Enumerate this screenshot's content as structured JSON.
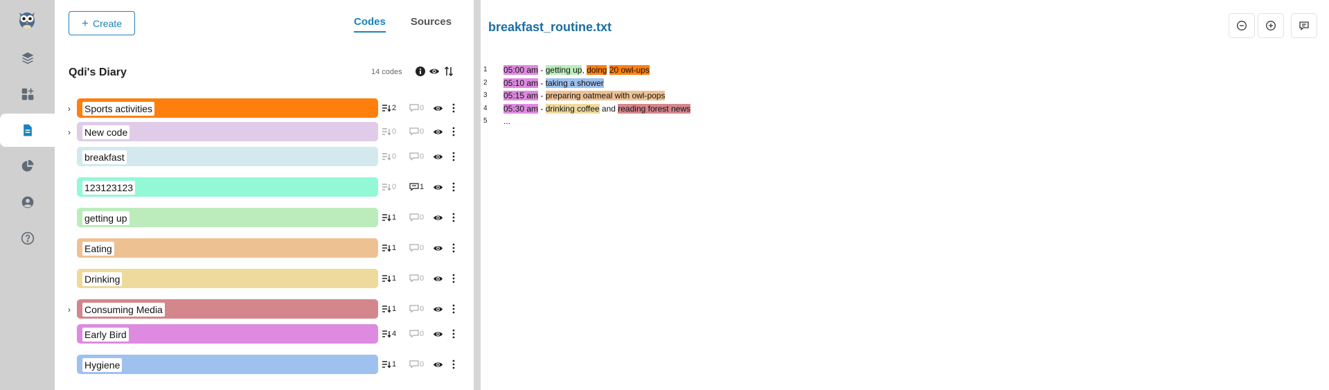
{
  "rail": {
    "items": [
      "documents-icon",
      "add-code-icon",
      "file-icon",
      "pie-chart-icon",
      "user-icon",
      "help-icon"
    ]
  },
  "toolbar": {
    "create_label": "Create"
  },
  "tabs": [
    {
      "label": "Codes",
      "active": true
    },
    {
      "label": "Sources",
      "active": false
    }
  ],
  "project": {
    "title": "Qdi's Diary",
    "code_count": "14 codes"
  },
  "codes": [
    {
      "name": "Sports activities",
      "color": "#fe7f0e",
      "expandable": true,
      "segments": "2",
      "memos": "0"
    },
    {
      "name": "New code",
      "color": "#e0cce8",
      "expandable": true,
      "segments": "0",
      "memos": "0"
    },
    {
      "name": "breakfast",
      "color": "#d3e9ee",
      "expandable": false,
      "segments": "0",
      "memos": "0"
    },
    {
      "name": "123123123",
      "color": "#92f8d6",
      "expandable": false,
      "segments": "0",
      "memos": "1"
    },
    {
      "name": "getting up",
      "color": "#bcecbc",
      "expandable": false,
      "segments": "1",
      "memos": "0"
    },
    {
      "name": "Eating",
      "color": "#eec193",
      "expandable": false,
      "segments": "1",
      "memos": "0"
    },
    {
      "name": "Drinking",
      "color": "#eeda9d",
      "expandable": false,
      "segments": "1",
      "memos": "0"
    },
    {
      "name": "Consuming Media",
      "color": "#d4868d",
      "expandable": true,
      "segments": "1",
      "memos": "0"
    },
    {
      "name": "Early Bird",
      "color": "#de8ae0",
      "expandable": false,
      "segments": "4",
      "memos": "0"
    },
    {
      "name": "Hygiene",
      "color": "#9ec1ef",
      "expandable": false,
      "segments": "1",
      "memos": "0"
    }
  ],
  "document": {
    "title": "breakfast_routine.txt",
    "lines": [
      {
        "num": "1",
        "parts": [
          {
            "text": "05:00 am",
            "color": "#de8ae0"
          },
          {
            "text": " - ",
            "color": ""
          },
          {
            "text": "getting up",
            "color": "#bcecbc"
          },
          {
            "text": ", ",
            "color": ""
          },
          {
            "text": "doing",
            "color": "#fe7f0e"
          },
          {
            "text": " ",
            "color": ""
          },
          {
            "text": "20 owl-ups",
            "color": "#fe7f0e"
          }
        ]
      },
      {
        "num": "2",
        "parts": [
          {
            "text": "05:10 am",
            "color": "#de8ae0"
          },
          {
            "text": " - ",
            "color": ""
          },
          {
            "text": "taking a shower",
            "color": "#9ec1ef"
          }
        ]
      },
      {
        "num": "3",
        "parts": [
          {
            "text": "05:15 am",
            "color": "#de8ae0"
          },
          {
            "text": " - ",
            "color": ""
          },
          {
            "text": "preparing oatmeal with owl-pops",
            "color": "#eec193"
          }
        ]
      },
      {
        "num": "4",
        "parts": [
          {
            "text": "05:30 am",
            "color": "#de8ae0"
          },
          {
            "text": " - ",
            "color": ""
          },
          {
            "text": "drinking coffee",
            "color": "#eeda9d"
          },
          {
            "text": " and ",
            "color": ""
          },
          {
            "text": "reading forest news",
            "color": "#d4868d"
          }
        ]
      },
      {
        "num": "5",
        "parts": [
          {
            "text": "...",
            "color": ""
          }
        ]
      }
    ]
  },
  "doc_actions": [
    "zoom-out-icon",
    "zoom-in-icon",
    "comment-icon"
  ]
}
